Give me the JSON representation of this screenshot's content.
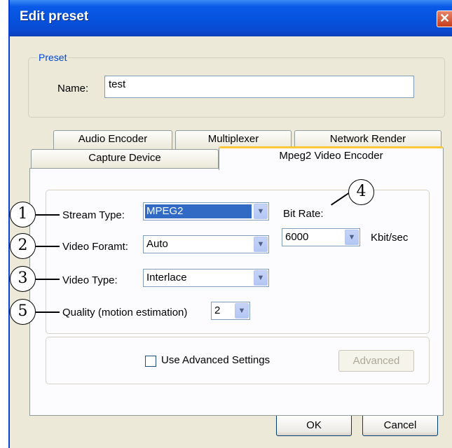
{
  "window": {
    "title": "Edit preset",
    "close_glyph": "✕"
  },
  "preset_group": {
    "legend": "Preset",
    "name_label": "Name:",
    "name_value": "test"
  },
  "tabs": [
    {
      "label": "Audio Encoder"
    },
    {
      "label": "Multiplexer"
    },
    {
      "label": "Network Render"
    },
    {
      "label": "Capture Device"
    },
    {
      "label": "Mpeg2 Video Encoder",
      "active": true
    }
  ],
  "encoder": {
    "stream_type": {
      "label": "Stream Type:",
      "value": "MPEG2"
    },
    "video_format": {
      "label": "Video Foramt:",
      "value": "Auto"
    },
    "video_type": {
      "label": "Video Type:",
      "value": "Interlace"
    },
    "quality": {
      "label": "Quality (motion estimation)",
      "value": "2"
    },
    "bit_rate": {
      "label": "Bit Rate:",
      "value": "6000",
      "unit": "Kbit/sec"
    }
  },
  "advanced": {
    "checkbox_label": "Use Advanced Settings",
    "checked": false,
    "button_label": "Advanced"
  },
  "footer": {
    "ok_label": "OK",
    "cancel_label": "Cancel"
  },
  "callouts": {
    "c1": "1",
    "c2": "2",
    "c3": "3",
    "c4": "4",
    "c5": "5"
  },
  "icons": {
    "dropdown_arrow": "chevron-down-icon",
    "close": "close-icon"
  },
  "colors": {
    "titlebar": "#0652dc",
    "selection": "#316ac5",
    "active_tab_accent": "#ffc83c",
    "group_legend": "#0046d5"
  }
}
